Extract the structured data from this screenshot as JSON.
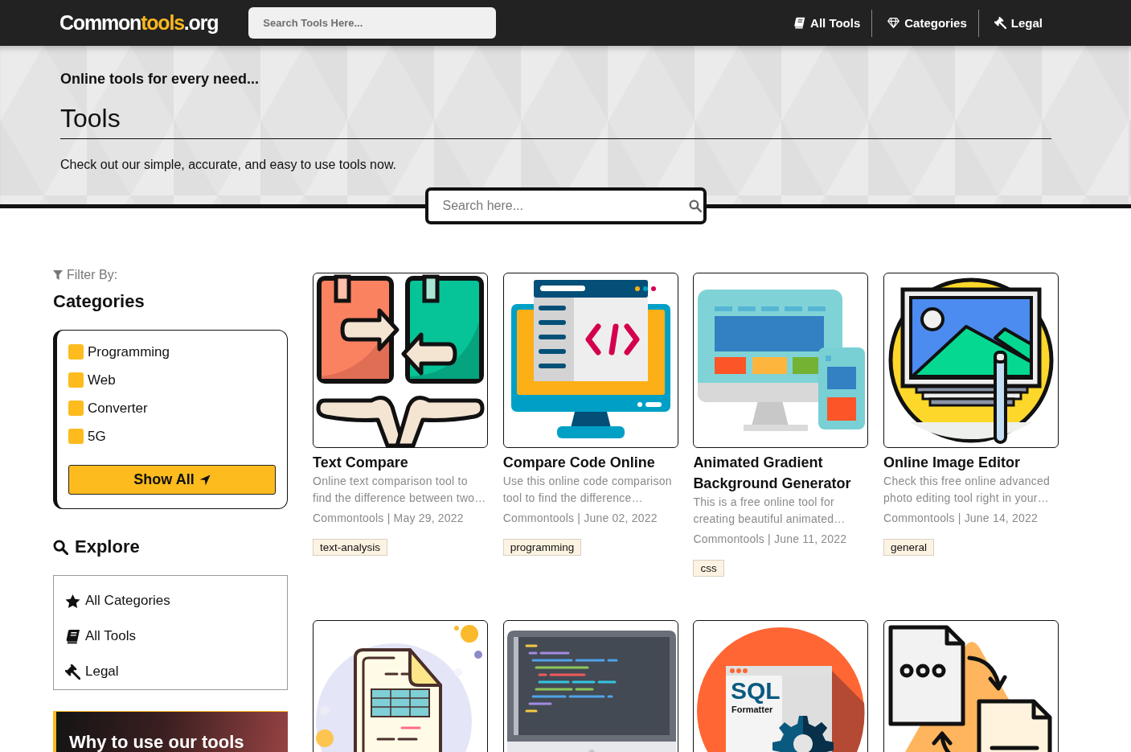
{
  "header": {
    "logo": "Common**tools**.org",
    "search": {
      "placeholder": "Search Tools Here..."
    },
    "nav": [
      {
        "label": "All Tools",
        "kind": "tools"
      },
      {
        "label": "Categories",
        "kind": "categories"
      },
      {
        "label": "Legal",
        "kind": "legal"
      }
    ]
  },
  "hero": {
    "tagline": "Online tools for every need...",
    "title": "Tools",
    "description": "Check out our simple, accurate, and easy to use tools now.",
    "search": {
      "placeholder": "Search here..."
    }
  },
  "sidebar": {
    "filter_label": "Filter By:",
    "categories": {
      "heading": "Categories",
      "items": [
        {
          "label": "Programming",
          "checked": false
        },
        {
          "label": "Web",
          "checked": false
        },
        {
          "label": "Converter",
          "checked": false
        },
        {
          "label": "5G",
          "checked": false
        }
      ],
      "button": "Show All"
    },
    "explore": {
      "heading": "Explore",
      "items": [
        {
          "label": "All Categories",
          "kind": "categories"
        },
        {
          "label": "All Tools",
          "kind": "tools"
        },
        {
          "label": "Legal",
          "kind": "legal"
        }
      ]
    },
    "promo": {
      "title": "Why to use our tools"
    }
  },
  "tools": [
    {
      "kind": "compare",
      "title": "Text Compare",
      "description": "Online text comparison tool to find the difference between two…",
      "meta": "Commontools | May 29, 2022",
      "tag": "text-analysis"
    },
    {
      "kind": "code",
      "title": "Compare Code Online",
      "description": "Use this online code comparison tool to find the difference…",
      "meta": "Commontools | June 02, 2022",
      "tag": "programming"
    },
    {
      "kind": "gradient",
      "title": "Animated Gradient Background Generator",
      "description": "This is a free online tool for creating beautiful animated…",
      "meta": "Commontools | June 11, 2022",
      "tag": "css"
    },
    {
      "kind": "image",
      "title": "Online Image Editor",
      "description": "Check this free online advanced photo editing tool right in your…",
      "meta": "Commontools | June 14, 2022",
      "tag": "general"
    },
    {
      "kind": "spreadsheet"
    },
    {
      "kind": "editor"
    },
    {
      "kind": "sql",
      "image_text": [
        "SQL",
        "Formatter"
      ]
    },
    {
      "kind": "convert"
    }
  ]
}
